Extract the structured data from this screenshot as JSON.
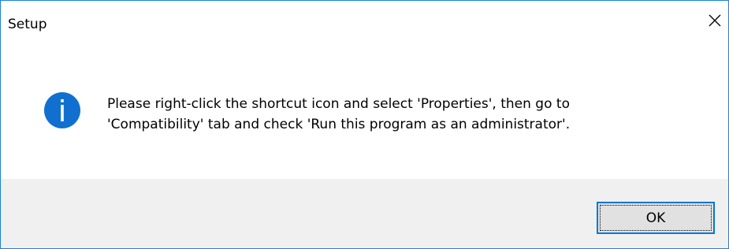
{
  "window": {
    "title": "Setup",
    "close_icon": "close-icon",
    "border_color": "#1883d7"
  },
  "message": {
    "icon": "info-icon",
    "icon_color": "#1170cf",
    "line1": "Please right-click the shortcut icon and select 'Properties', then go to",
    "line2": "'Compatibility' tab and check 'Run this program as an administrator'."
  },
  "buttons": {
    "ok_label": "OK",
    "ok_border_color": "#0078d7"
  }
}
